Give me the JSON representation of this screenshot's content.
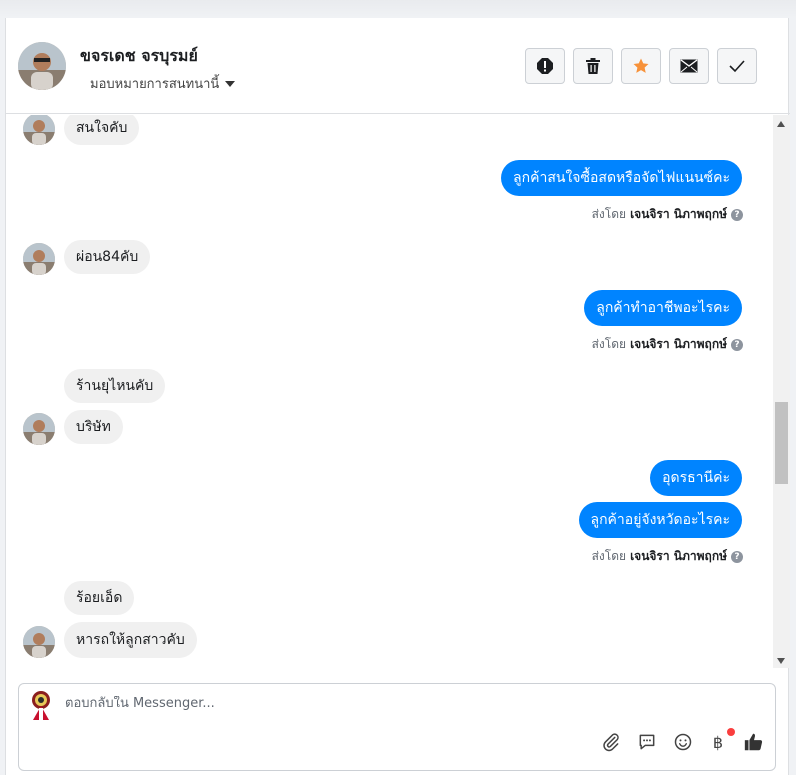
{
  "header": {
    "contact_name": "ขจรเดช จรบุรมย์",
    "assign_label": "มอบหมายการสนทนานี้",
    "buttons": [
      {
        "name": "spam-button",
        "icon": "alert-icon"
      },
      {
        "name": "delete-button",
        "icon": "trash-icon"
      },
      {
        "name": "follow-up-button",
        "icon": "star-icon"
      },
      {
        "name": "unread-button",
        "icon": "envelope-icon"
      },
      {
        "name": "done-button",
        "icon": "check-icon"
      }
    ]
  },
  "messages": [
    {
      "dir": "in",
      "text": "สนใจคับ"
    },
    {
      "dir": "out",
      "text": "ลูกค้าสนใจซื้อสดหรือจัดไฟแนนซ์คะ"
    },
    {
      "dir": "meta",
      "prefix": "ส่งโดย",
      "sender": "เจนจิรา นิภาพฤกษ์"
    },
    {
      "dir": "in",
      "text": "ผ่อน84คับ"
    },
    {
      "dir": "out",
      "text": "ลูกค้าทำอาชีพอะไรคะ"
    },
    {
      "dir": "meta",
      "prefix": "ส่งโดย",
      "sender": "เจนจิรา นิภาพฤกษ์"
    },
    {
      "dir": "in",
      "text": "ร้านยุไหนคับ"
    },
    {
      "dir": "in",
      "text": "บริษัท"
    },
    {
      "dir": "out",
      "text": "อุดรธานีค่ะ"
    },
    {
      "dir": "out",
      "text": "ลูกค้าอยู่จังหวัดอะไรคะ"
    },
    {
      "dir": "meta",
      "prefix": "ส่งโดย",
      "sender": "เจนจิรา นิภาพฤกษ์"
    },
    {
      "dir": "in",
      "text": "ร้อยเอ็ด"
    },
    {
      "dir": "in",
      "text": "หารถให้ลูกสาวคับ"
    }
  ],
  "composer": {
    "placeholder": "ตอบกลับใน Messenger...",
    "value": "",
    "currency_symbol": "฿"
  },
  "colors": {
    "outgoing_bubble": "#0084ff",
    "incoming_bubble": "#f0f0f0",
    "star": "#f7923a",
    "notification_dot": "#fa3e3e"
  }
}
